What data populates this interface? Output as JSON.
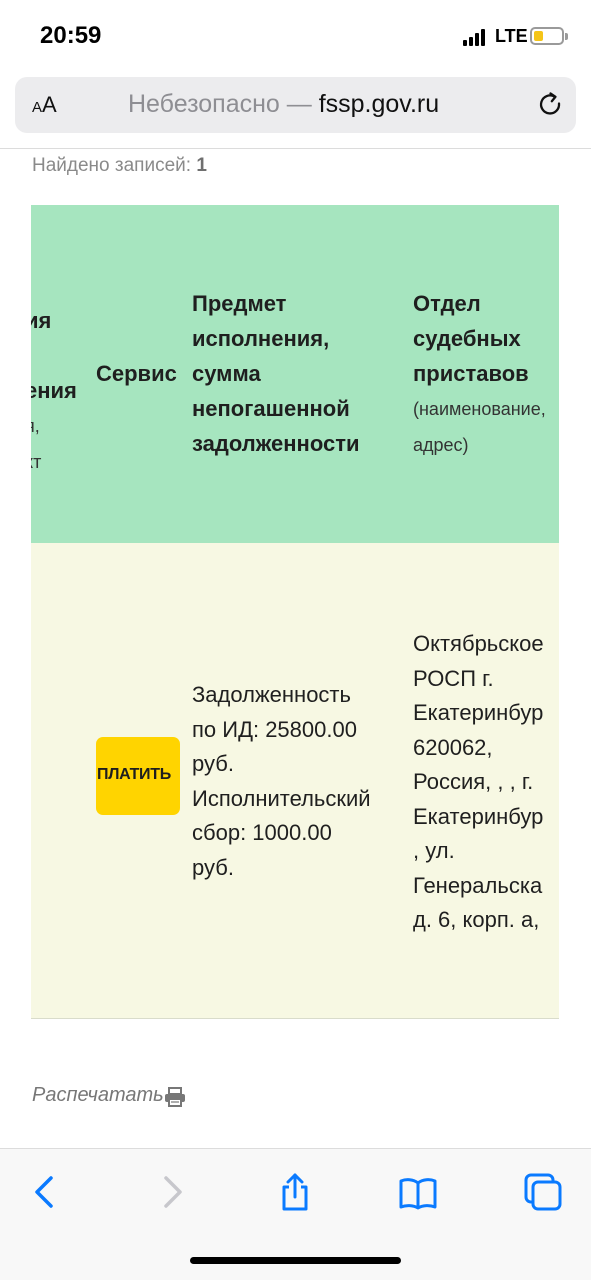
{
  "status_bar": {
    "time": "20:59",
    "network": "LTE",
    "signal_bars": 4,
    "battery_level": 0.25,
    "battery_color": "#f5c518"
  },
  "browser": {
    "text_size_label_small": "A",
    "text_size_label_large": "A",
    "security_prefix": "Небезопасно — ",
    "host": "fssp.gov.ru",
    "reload_icon": "reload-icon"
  },
  "page": {
    "records_label": "Найдено записей: ",
    "records_count": "1",
    "table": {
      "header_bg": "#a6e5bf",
      "body_bg": "#f7f8e3",
      "partial_column_lines": [
        "ия",
        "",
        "ения",
        "я,",
        "кт",
        "("
      ],
      "service_header": "Сервис",
      "subject_header_lines": [
        "Предмет",
        "исполнения,",
        "сумма",
        "непогашенной",
        "задолженности"
      ],
      "department_header_lines": [
        "Отдел",
        "судебных",
        "приставов"
      ],
      "department_header_sub_lines": [
        "(наименование,",
        "адрес)"
      ],
      "pay_button_label": "ПЛАТИТЬ",
      "pay_button_color": "#ffd400",
      "subject_lines": [
        "Задолженность",
        "по ИД: 25800.00",
        "руб.",
        "Исполнительский",
        "сбор: 1000.00",
        "руб."
      ],
      "department_lines": [
        "Октябрьское",
        "РОСП г.",
        "Екатеринбур",
        "620062,",
        "Россия, , , г.",
        "Екатеринбур",
        ", ул.",
        "Генеральска",
        "д. 6, корп. а,"
      ]
    },
    "print_label": "Распечатать",
    "print_icon": "printer-icon"
  },
  "toolbar": {
    "icons": [
      "back-icon",
      "forward-icon",
      "share-icon",
      "bookmarks-icon",
      "tabs-icon"
    ],
    "accent": "#0a7aff"
  }
}
